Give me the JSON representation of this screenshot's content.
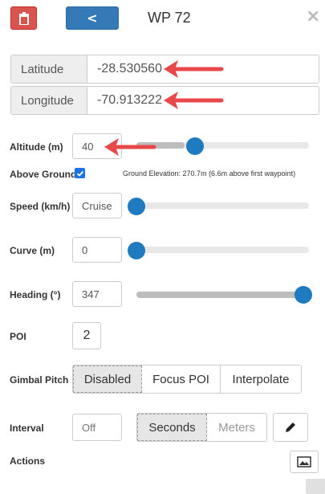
{
  "header": {
    "title": "WP 72",
    "back_label": "<",
    "close_label": "×"
  },
  "coords": {
    "latitude_label": "Latitude",
    "latitude_value": "-28.530560",
    "longitude_label": "Longitude",
    "longitude_value": "-70.913222"
  },
  "altitude": {
    "label": "Altitude (m)",
    "value": "40",
    "slider_fraction": 0.28
  },
  "above_ground": {
    "label": "Above Ground",
    "checked": true,
    "ground_elevation": "Ground Elevation: 270.7m (6.6m above first waypoint)"
  },
  "speed": {
    "label": "Speed (km/h)",
    "value": "Cruise",
    "slider_fraction": 0.0
  },
  "curve": {
    "label": "Curve (m)",
    "value": "0",
    "slider_fraction": 0.0
  },
  "heading": {
    "label": "Heading (°)",
    "value": "347",
    "slider_fraction": 1.0
  },
  "poi": {
    "label": "POI",
    "value": "2"
  },
  "gimbal": {
    "label": "Gimbal Pitch",
    "options": [
      "Disabled",
      "Focus POI",
      "Interpolate"
    ],
    "selected": "Disabled"
  },
  "interval": {
    "label": "Interval",
    "value": "Off",
    "units": [
      "Seconds",
      "Meters"
    ],
    "selected_unit": "Seconds"
  },
  "actions": {
    "label": "Actions"
  },
  "icons": {
    "delete": "trash-icon",
    "edit": "pencil-icon",
    "image": "image-icon",
    "close": "close-icon"
  },
  "colors": {
    "danger": "#d9534f",
    "primary": "#337ab7",
    "slider_thumb": "#1f7bbf",
    "annotation_arrow": "#e8484a"
  }
}
